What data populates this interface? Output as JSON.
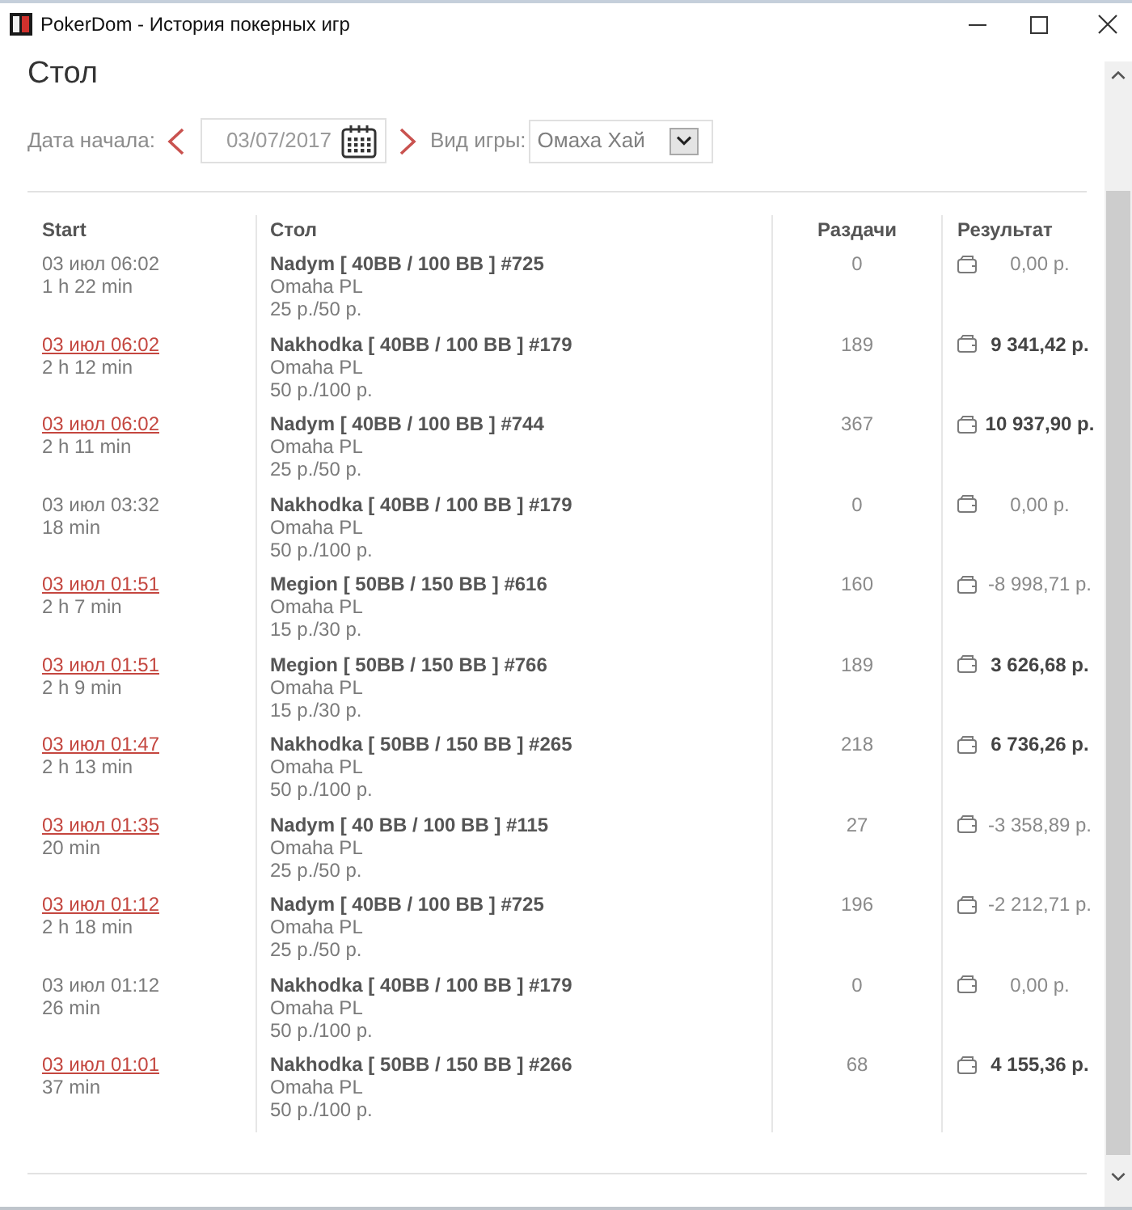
{
  "window": {
    "title": "PokerDom - История покерных игр"
  },
  "heading": "Стол",
  "filters": {
    "date_label": "Дата начала:",
    "date": "03/07/2017",
    "game_label": "Вид игры:",
    "game": "Омаха Хай"
  },
  "table": {
    "columns": [
      "Start",
      "Стол",
      "Раздачи",
      "Результат"
    ],
    "rows": [
      {
        "start": "03 июл 06:02",
        "link": false,
        "duration": "1 h 22 min",
        "table": "Nadym [ 40BB / 100 BB ] #725",
        "game": "Omaha PL",
        "stakes": "25 р./50 р.",
        "hands": "0",
        "result": "0,00 р.",
        "bold": false
      },
      {
        "start": "03 июл 06:02",
        "link": true,
        "duration": "2 h 12 min",
        "table": "Nakhodka [ 40BB / 100 BB ] #179",
        "game": "Omaha PL",
        "stakes": "50 р./100 р.",
        "hands": "189",
        "result": "9 341,42 р.",
        "bold": true
      },
      {
        "start": "03 июл 06:02",
        "link": true,
        "duration": "2 h 11 min",
        "table": "Nadym [ 40BB / 100 BB ] #744",
        "game": "Omaha PL",
        "stakes": "25 р./50 р.",
        "hands": "367",
        "result": "10 937,90 р.",
        "bold": true
      },
      {
        "start": "03 июл 03:32",
        "link": false,
        "duration": "18 min",
        "table": "Nakhodka [ 40BB / 100 BB ] #179",
        "game": "Omaha PL",
        "stakes": "50 р./100 р.",
        "hands": "0",
        "result": "0,00 р.",
        "bold": false
      },
      {
        "start": "03 июл 01:51",
        "link": true,
        "duration": "2 h 7 min",
        "table": "Megion [ 50BB / 150 BB ] #616",
        "game": "Omaha PL",
        "stakes": "15 р./30 р.",
        "hands": "160",
        "result": "-8 998,71 р.",
        "bold": false
      },
      {
        "start": "03 июл 01:51",
        "link": true,
        "duration": "2 h 9 min",
        "table": "Megion [ 50BB / 150 BB ] #766",
        "game": "Omaha PL",
        "stakes": "15 р./30 р.",
        "hands": "189",
        "result": "3 626,68 р.",
        "bold": true
      },
      {
        "start": "03 июл 01:47",
        "link": true,
        "duration": "2 h 13 min",
        "table": "Nakhodka [ 50BB / 150 BB ] #265",
        "game": "Omaha PL",
        "stakes": "50 р./100 р.",
        "hands": "218",
        "result": "6 736,26 р.",
        "bold": true
      },
      {
        "start": "03 июл 01:35",
        "link": true,
        "duration": "20 min",
        "table": "Nadym [ 40 BB / 100 BB ] #115",
        "game": "Omaha PL",
        "stakes": "25 р./50 р.",
        "hands": "27",
        "result": "-3 358,89 р.",
        "bold": false
      },
      {
        "start": "03 июл 01:12",
        "link": true,
        "duration": "2 h 18 min",
        "table": "Nadym [ 40BB / 100 BB ] #725",
        "game": "Omaha PL",
        "stakes": "25 р./50 р.",
        "hands": "196",
        "result": "-2 212,71 р.",
        "bold": false
      },
      {
        "start": "03 июл 01:12",
        "link": false,
        "duration": "26 min",
        "table": "Nakhodka [ 40BB / 100 BB ] #179",
        "game": "Omaha PL",
        "stakes": "50 р./100 р.",
        "hands": "0",
        "result": "0,00 р.",
        "bold": false
      },
      {
        "start": "03 июл 01:01",
        "link": true,
        "duration": "37 min",
        "table": "Nakhodka [ 50BB / 150 BB ] #266",
        "game": "Omaha PL",
        "stakes": "50 р./100 р.",
        "hands": "68",
        "result": "4 155,36 р.",
        "bold": true
      }
    ]
  }
}
